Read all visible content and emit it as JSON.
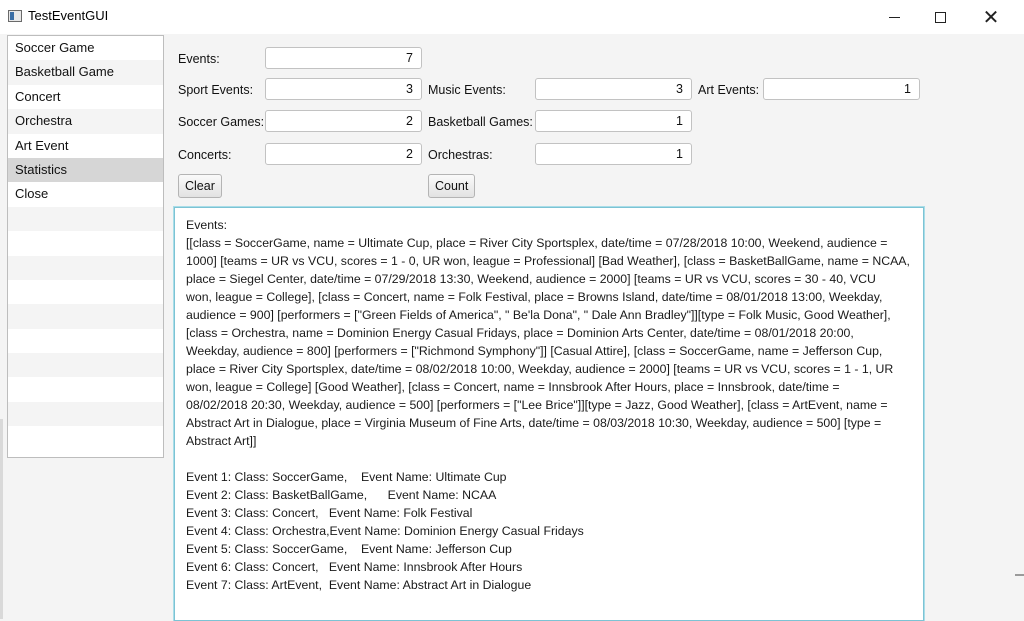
{
  "window": {
    "title": "TestEventGUI"
  },
  "sidebar": {
    "items": [
      {
        "label": "Soccer Game"
      },
      {
        "label": "Basketball Game"
      },
      {
        "label": "Concert"
      },
      {
        "label": "Orchestra"
      },
      {
        "label": "Art Event"
      },
      {
        "label": "Statistics"
      },
      {
        "label": "Close"
      }
    ],
    "selected": "Statistics"
  },
  "stats": {
    "events_label": "Events:",
    "events_value": "7",
    "sport_label": "Sport Events:",
    "sport_value": "3",
    "music_label": "Music Events:",
    "music_value": "3",
    "art_label": "Art Events:",
    "art_value": "1",
    "soccer_label": "Soccer Games:",
    "soccer_value": "2",
    "basketball_label": "Basketball Games:",
    "basketball_value": "1",
    "concerts_label": "Concerts:",
    "concerts_value": "2",
    "orchestras_label": "Orchestras:",
    "orchestras_value": "1"
  },
  "buttons": {
    "clear": "Clear",
    "count": "Count"
  },
  "output": {
    "lines": [
      "Events:",
      "[[class = SoccerGame, name = Ultimate Cup, place = River City Sportsplex, date/time = 07/28/2018 10:00, Weekend, audience =",
      "1000] [teams = UR vs VCU, scores = 1 - 0, UR won, league = Professional] [Bad Weather], [class = BasketBallGame, name = NCAA,",
      "place = Siegel Center, date/time = 07/29/2018 13:30, Weekend, audience = 2000] [teams = UR vs VCU, scores = 30 - 40, VCU",
      "won, league = College], [class = Concert, name = Folk Festival, place = Browns Island, date/time = 08/01/2018 13:00, Weekday,",
      "audience = 900] [performers = [\"Green Fields of America\", \" Be'la Dona\", \" Dale Ann Bradley\"]][type = Folk Music, Good Weather],",
      "[class = Orchestra, name = Dominion Energy Casual Fridays, place = Dominion Arts Center, date/time = 08/01/2018 20:00,",
      "Weekday, audience = 800] [performers = [\"Richmond Symphony\"]] [Casual Attire], [class = SoccerGame, name = Jefferson Cup,",
      "place = River City Sportsplex, date/time = 08/02/2018 10:00, Weekday, audience = 2000] [teams = UR vs VCU, scores = 1 - 1, UR",
      "won, league = College] [Good Weather], [class = Concert, name = Innsbrook After Hours, place = Innsbrook, date/time =",
      "08/02/2018 20:30, Weekday, audience = 500] [performers = [\"Lee Brice\"]][type = Jazz, Good Weather], [class = ArtEvent, name =",
      "Abstract Art in Dialogue, place = Virginia Museum of Fine Arts, date/time = 08/03/2018 10:30, Weekday, audience = 500] [type =",
      "Abstract Art]]",
      "",
      "Event 1: Class: SoccerGame,    Event Name: Ultimate Cup",
      "Event 2: Class: BasketBallGame,      Event Name: NCAA",
      "Event 3: Class: Concert,   Event Name: Folk Festival",
      "Event 4: Class: Orchestra,Event Name: Dominion Energy Casual Fridays",
      "Event 5: Class: SoccerGame,    Event Name: Jefferson Cup",
      "Event 6: Class: Concert,   Event Name: Innsbrook After Hours",
      "Event 7: Class: ArtEvent,  Event Name: Abstract Art in Dialogue"
    ]
  },
  "icons": {
    "app": "app-window-icon",
    "minimize": "minimize-icon",
    "maximize": "maximize-icon",
    "close": "close-icon"
  },
  "colors": {
    "focus_border": "#7cc3d4",
    "selected_item": "#d6d6d6"
  }
}
